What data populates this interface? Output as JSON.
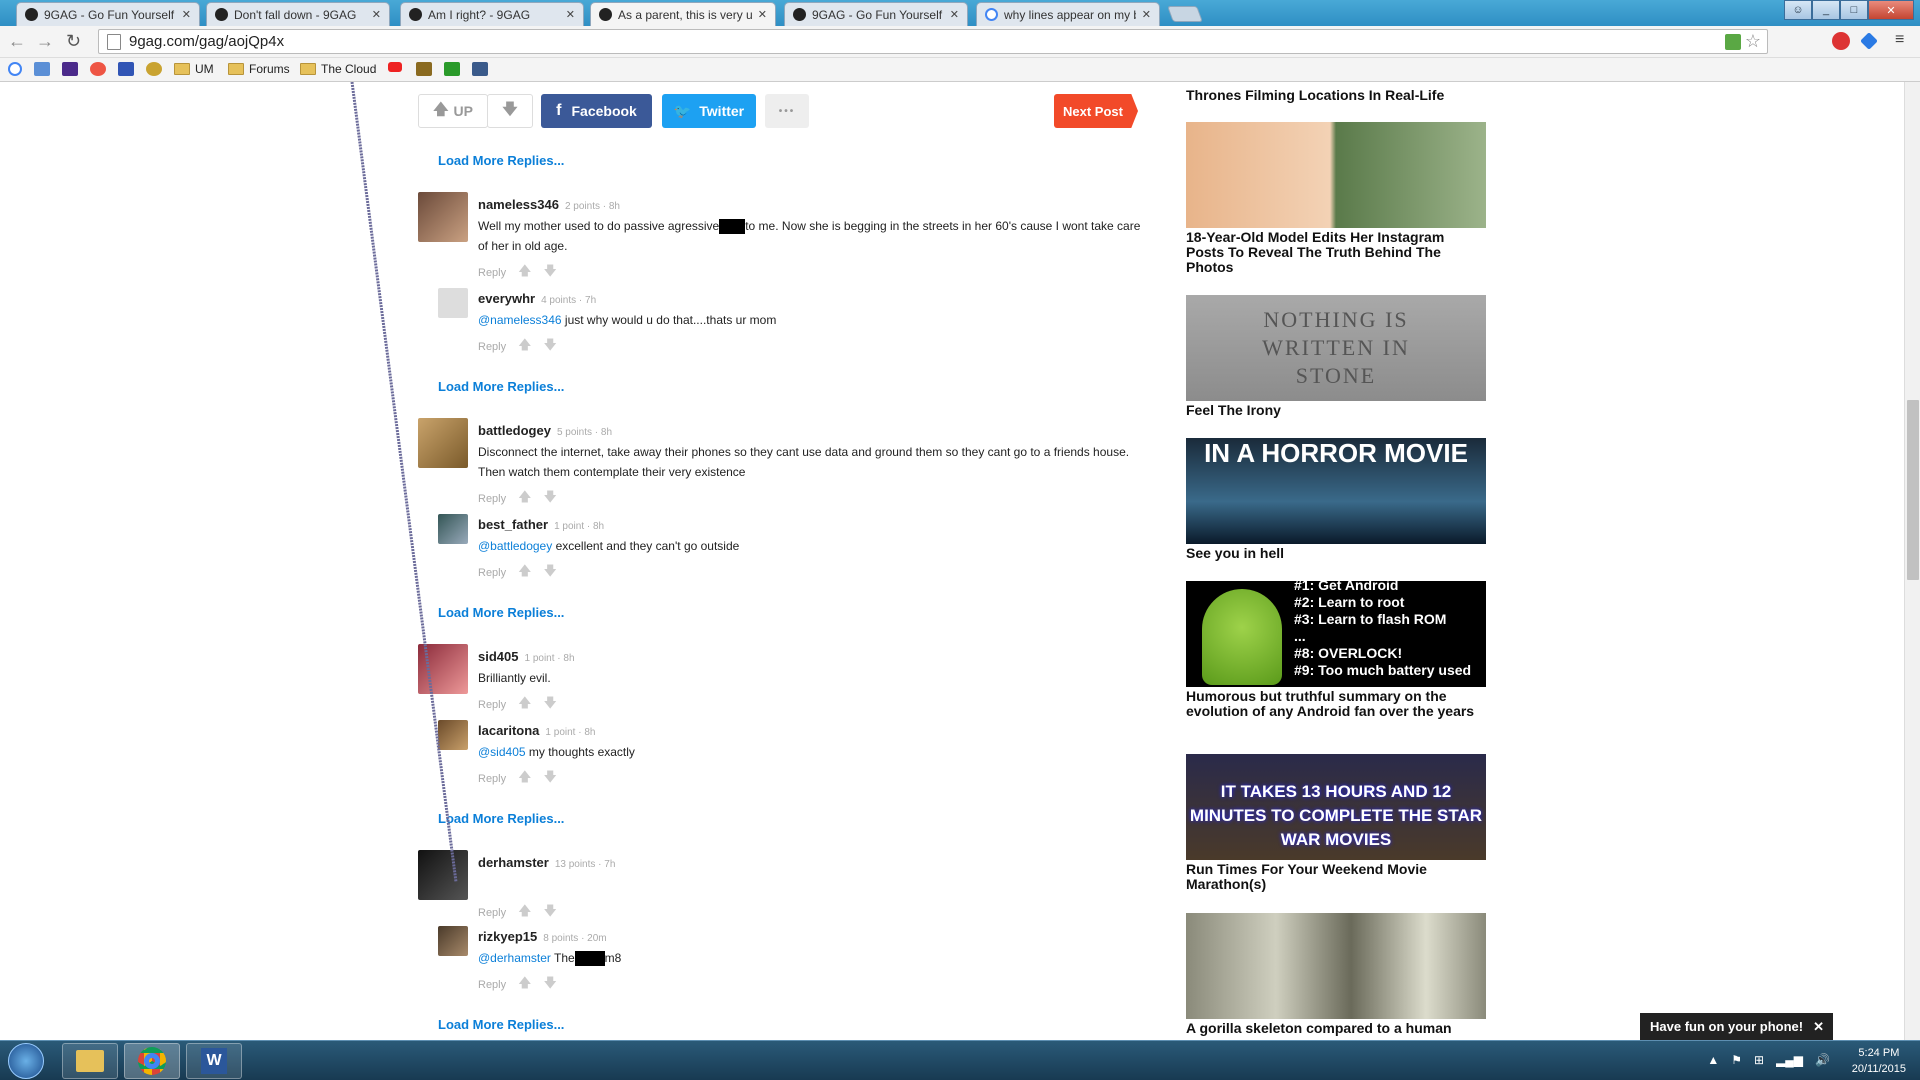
{
  "browser": {
    "tabs": [
      {
        "title": "9GAG - Go Fun Yourself",
        "favicon": "9gag-icon",
        "active": false
      },
      {
        "title": "Don't fall down - 9GAG",
        "favicon": "9gag-icon",
        "active": false
      },
      {
        "title": "Am I right? - 9GAG",
        "favicon": "9gag-icon",
        "active": false
      },
      {
        "title": "As a parent, this is very us",
        "favicon": "9gag-icon",
        "active": true
      },
      {
        "title": "9GAG - Go Fun Yourself",
        "favicon": "9gag-icon",
        "active": false
      },
      {
        "title": "why lines appear on my b",
        "favicon": "google-icon",
        "active": false
      }
    ],
    "url": "9gag.com/gag/aojQp4x",
    "bookmarks": [
      {
        "label": "UM",
        "type": "folder"
      },
      {
        "label": "Forums",
        "type": "folder"
      },
      {
        "label": "The Cloud",
        "type": "folder"
      }
    ]
  },
  "post_actions": {
    "up_label": "UP",
    "facebook_label": "Facebook",
    "twitter_label": "Twitter",
    "more_label": "•••",
    "next_label": "Next Post"
  },
  "load_more_label": "Load More Replies...",
  "reply_label": "Reply",
  "comments": [
    {
      "user": "nameless346",
      "meta": "2 points · 8h",
      "text_before": "Well my mother used to do passive agressive",
      "text_after": "to me. Now she is begging in the streets in her 60's cause I wont take care of her in old age."
    },
    {
      "user": "everywhr",
      "meta": "4 points · 7h",
      "mention": "@nameless346",
      "text": " just why would u do that....thats ur mom"
    },
    {
      "user": "battledogey",
      "meta": "5 points · 8h",
      "text": "Disconnect the internet, take away their phones so they cant use data and ground them so they cant go to a friends house. Then watch them contemplate their very existence"
    },
    {
      "user": "best_father",
      "meta": "1 point · 8h",
      "mention": "@battledogey",
      "text": " excellent and they can't go outside"
    },
    {
      "user": "sid405",
      "meta": "1 point · 8h",
      "text": "Brilliantly evil."
    },
    {
      "user": "lacaritona",
      "meta": "1 point · 8h",
      "mention": "@sid405",
      "text": " my thoughts exactly"
    },
    {
      "user": "derhamster",
      "meta": "13 points · 7h",
      "text": ""
    },
    {
      "user": "rizkyep15",
      "meta": "8 points · 20m",
      "mention": "@derhamster",
      "text_before": " The",
      "text_after": "m8"
    }
  ],
  "sidebar": [
    {
      "title": "Thrones Filming Locations In Real-Life"
    },
    {
      "title": "18-Year-Old Model Edits Her Instagram Posts To Reveal The Truth Behind The Photos"
    },
    {
      "title": "Feel The Irony",
      "image_text": "NOTHING IS WRITTEN IN STONE"
    },
    {
      "title": "See you in hell",
      "image_text": "IN A HORROR MOVIE"
    },
    {
      "title": "Humorous but truthful summary on the evolution of any Android fan over the years",
      "image_text": "#1: Get Android\n#2: Learn to root\n#3: Learn to flash ROM\n...\n#8: OVERLOCK!\n#9: Too much battery used"
    },
    {
      "title": "Run Times For Your Weekend Movie Marathon(s)",
      "image_text": "IT TAKES 13 HOURS AND 12 MINUTES TO COMPLETE THE STAR WAR MOVIES"
    },
    {
      "title": "A gorilla skeleton compared to a human"
    }
  ],
  "toast": {
    "text": "Have fun on your phone!",
    "close": "✕"
  },
  "taskbar": {
    "time": "5:24 PM",
    "date": "20/11/2015"
  },
  "colors": {
    "link_blue": "#0b7fd8",
    "facebook": "#3b5998",
    "twitter": "#1da1f2",
    "next_post": "#f24a29"
  }
}
